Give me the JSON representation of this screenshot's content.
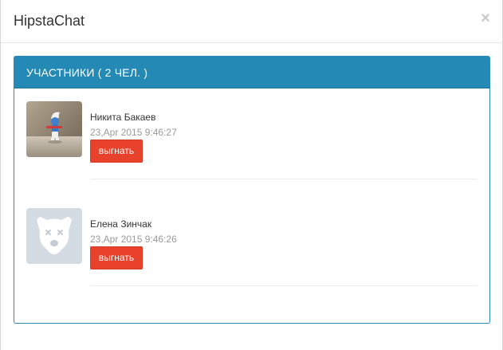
{
  "modal": {
    "title": "HipstaChat",
    "close_label": "×"
  },
  "panel": {
    "title": "УЧАСТНИКИ ( 2 ЧЕЛ. )"
  },
  "members": [
    {
      "name": "Никита Бакаев",
      "time": "23,Apr 2015 9:46:27",
      "kick_label": "выгнать",
      "avatar": "smurf-photo"
    },
    {
      "name": "Елена Зинчак",
      "time": "23,Apr 2015 9:46:26",
      "kick_label": "выгнать",
      "avatar": "deactivated-dog-icon"
    }
  ],
  "colors": {
    "panel_header": "#2589b5",
    "kick_button": "#e8412c"
  }
}
